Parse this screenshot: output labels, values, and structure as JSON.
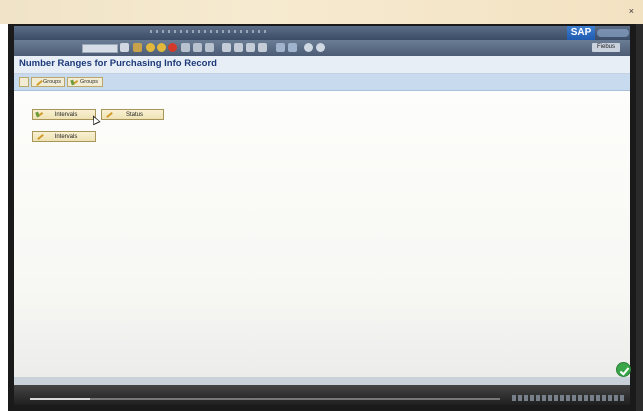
{
  "page": {
    "title": "Number Ranges for Purchasing Info Record"
  },
  "app_toolbar": {
    "groups_change_label": "Groups",
    "groups_display_label": "Groups"
  },
  "actions": {
    "intervals_display_label": "Intervals",
    "status_label": "Status",
    "intervals_change_label": "Intervals"
  },
  "system": {
    "logo_text": "SAP",
    "exit_label": "Fiebus"
  },
  "colors": {
    "title_text": "#1d3a7a",
    "app_toolbar_bg": "#c7daee",
    "button_bg": "#f2e6bd",
    "status_ok": "#3aa64a"
  },
  "icons": {
    "display_change": "change-icon",
    "change": "pencil-icon",
    "status_ok": "checkmark-icon"
  }
}
